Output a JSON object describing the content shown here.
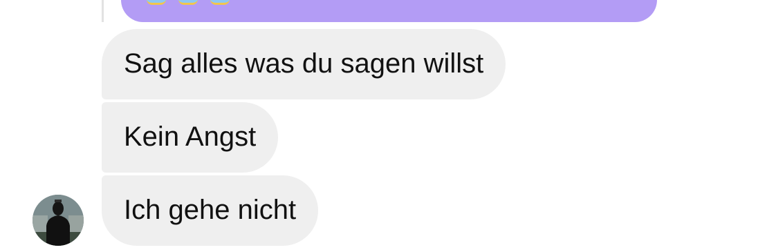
{
  "colors": {
    "background": "#ffffff",
    "incoming_bubble": "#efefef",
    "quoted_bubble": "#b39cf5",
    "text": "#111111"
  },
  "chat": {
    "quoted_message": {
      "icons": [
        "emoji-icon",
        "emoji-icon",
        "emoji-icon"
      ]
    },
    "messages": [
      {
        "text": "Sag alles was du sagen willst"
      },
      {
        "text": "Kein Angst"
      },
      {
        "text": "Ich gehe nicht"
      }
    ],
    "sender": {
      "avatar_icon": "profile-photo-avatar"
    }
  }
}
